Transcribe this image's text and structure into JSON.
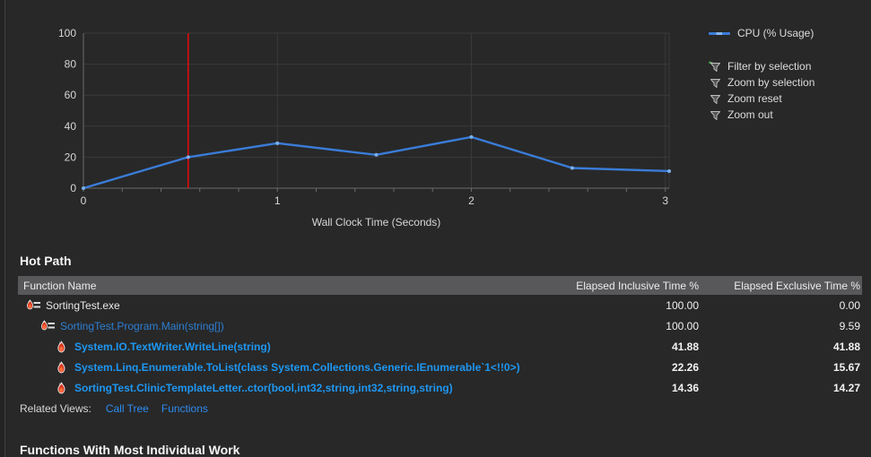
{
  "chart": {
    "series_label": "CPU (% Usage)",
    "actions": [
      {
        "label": "Filter by selection",
        "icon": "filter-by-selection-icon",
        "accent": true
      },
      {
        "label": "Zoom by selection",
        "icon": "zoom-by-selection-icon",
        "accent": false
      },
      {
        "label": "Zoom reset",
        "icon": "zoom-reset-icon",
        "accent": false
      },
      {
        "label": "Zoom out",
        "icon": "zoom-out-icon",
        "accent": false
      }
    ]
  },
  "chart_data": {
    "type": "line",
    "title": "",
    "xlabel": "Wall Clock Time (Seconds)",
    "ylabel": "",
    "xlim": [
      0,
      3.02
    ],
    "ylim": [
      0,
      100
    ],
    "yticks": [
      0,
      20,
      40,
      60,
      80,
      100
    ],
    "xticks": [
      0,
      1,
      2,
      3
    ],
    "minor_xtick_step": 0.2,
    "grid": true,
    "legend_position": "top-right",
    "cursor_x": 0.54,
    "series": [
      {
        "name": "CPU (% Usage)",
        "x": [
          0,
          0.54,
          1.0,
          1.51,
          2.0,
          2.52,
          3.02
        ],
        "y": [
          0,
          20,
          29,
          21.5,
          33,
          13,
          11
        ]
      }
    ],
    "colors": {
      "line": "#3a7cd8",
      "marker": "#7ab0ea",
      "cursor": "#ea0a0a",
      "grid": "#3a3a3a",
      "axis": "#6a6a6a",
      "tick_label": "#d6d6d6"
    }
  },
  "hot_path": {
    "title": "Hot Path",
    "columns": [
      "Function Name",
      "Elapsed Inclusive Time %",
      "Elapsed Exclusive Time %"
    ],
    "rows": [
      {
        "name": "SortingTest.exe",
        "inclusive": "100.00",
        "exclusive": "0.00",
        "indent": 0,
        "icon": "hot-path-icon",
        "style": "plain"
      },
      {
        "name": "SortingTest.Program.Main(string[])",
        "inclusive": "100.00",
        "exclusive": "9.59",
        "indent": 1,
        "icon": "hot-path-icon",
        "style": "link"
      },
      {
        "name": "System.IO.TextWriter.WriteLine(string)",
        "inclusive": "41.88",
        "exclusive": "41.88",
        "indent": 2,
        "icon": "flame-icon",
        "style": "hot"
      },
      {
        "name": "System.Linq.Enumerable.ToList(class System.Collections.Generic.IEnumerable`1<!!0>)",
        "inclusive": "22.26",
        "exclusive": "15.67",
        "indent": 2,
        "icon": "flame-icon",
        "style": "hot"
      },
      {
        "name": "SortingTest.ClinicTemplateLetter..ctor(bool,int32,string,int32,string,string)",
        "inclusive": "14.36",
        "exclusive": "14.27",
        "indent": 2,
        "icon": "flame-icon",
        "style": "hot"
      }
    ]
  },
  "related_views": {
    "label": "Related Views:",
    "links": [
      "Call Tree",
      "Functions"
    ]
  },
  "individual_work": {
    "title": "Functions With Most Individual Work"
  },
  "colors": {
    "page_bg": "#282828",
    "header_bg": "#58585a",
    "link": "#2d7fd4",
    "hot_link": "#1e97f2",
    "flame_red": "#d93a20"
  }
}
